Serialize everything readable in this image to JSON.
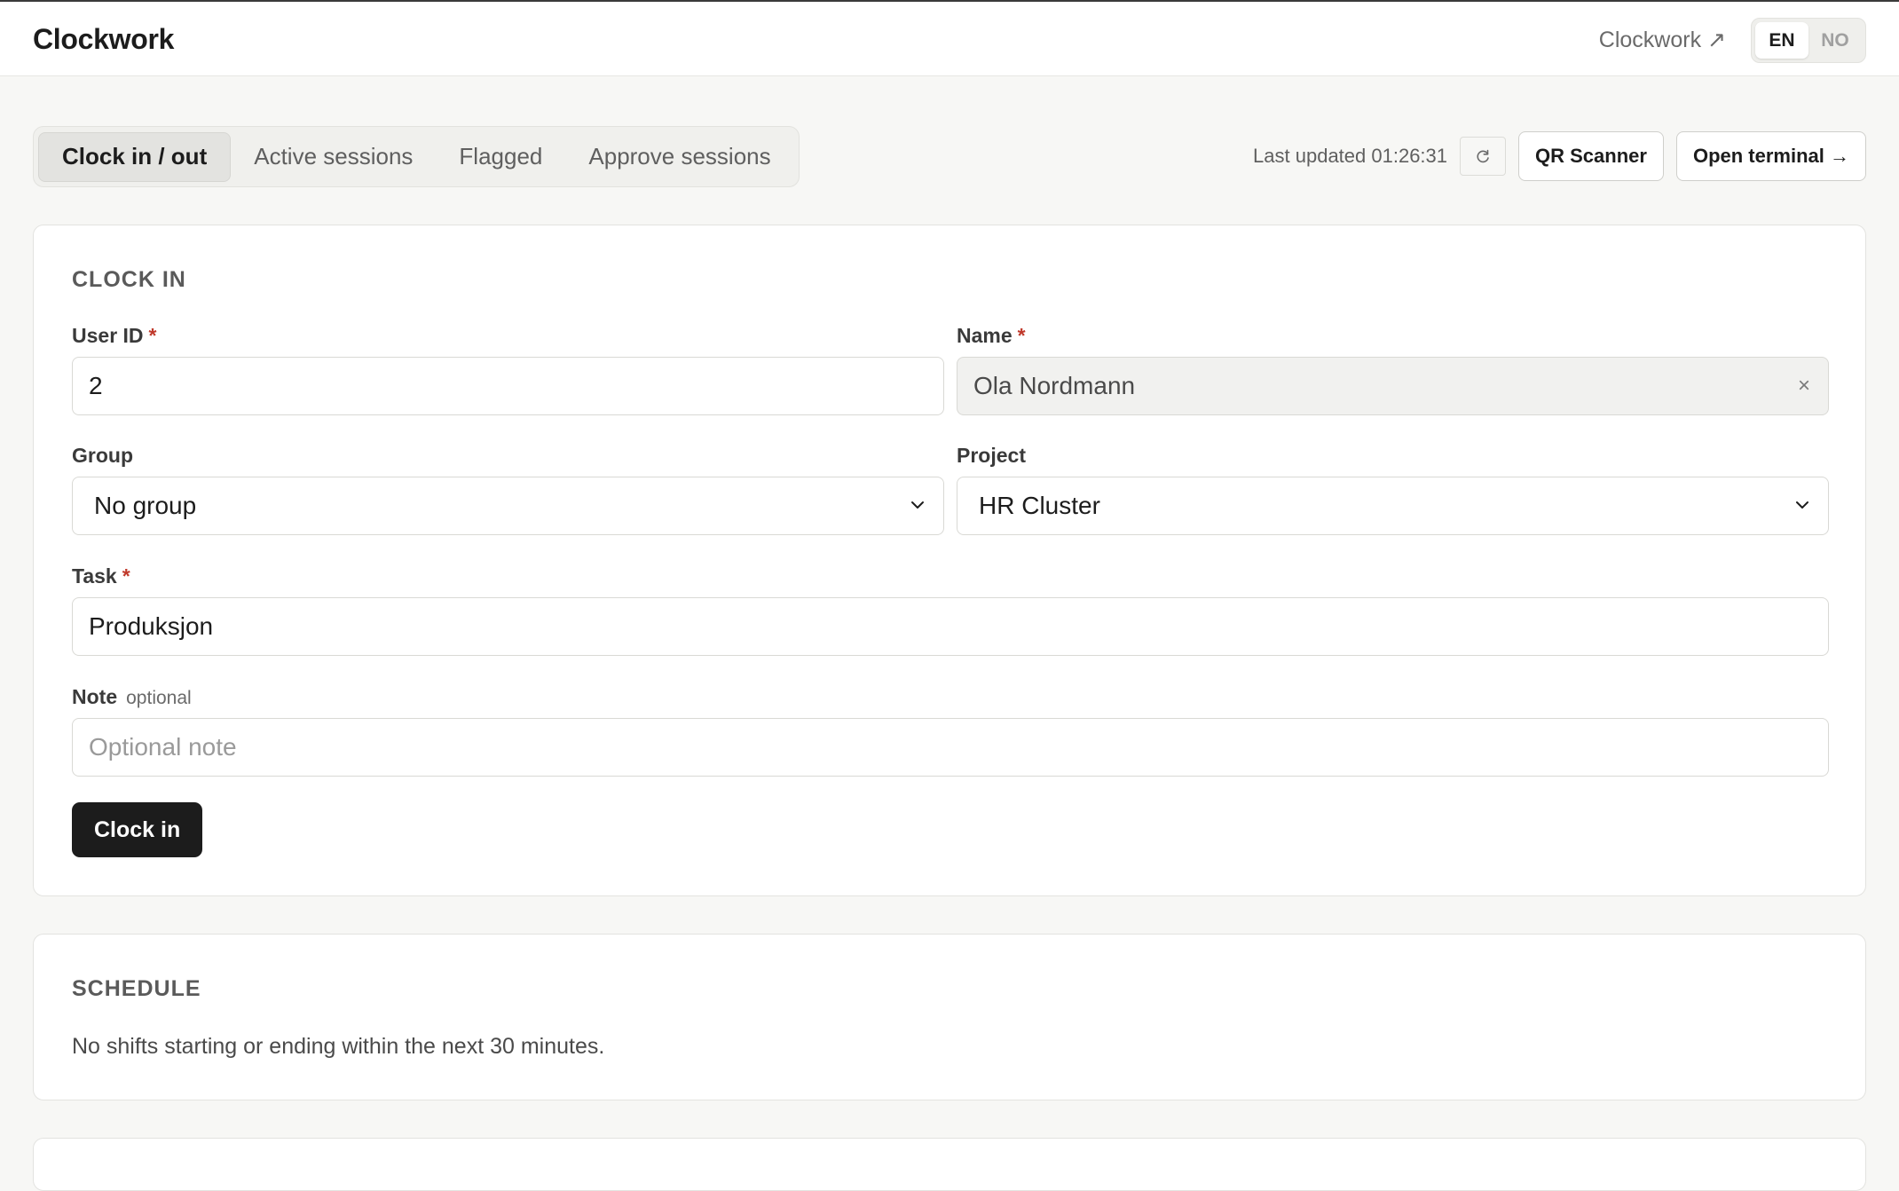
{
  "header": {
    "brand": "Clockwork",
    "external_link": "Clockwork ↗",
    "languages": [
      {
        "code": "EN",
        "active": true
      },
      {
        "code": "NO",
        "active": false
      }
    ]
  },
  "tabs": [
    {
      "label": "Clock in / out",
      "active": true
    },
    {
      "label": "Active sessions",
      "active": false
    },
    {
      "label": "Flagged",
      "active": false
    },
    {
      "label": "Approve sessions",
      "active": false
    }
  ],
  "toolbar": {
    "last_updated": "Last updated 01:26:31",
    "refresh_icon": "refresh-icon",
    "qr_button": "QR Scanner",
    "terminal_button": "Open terminal →"
  },
  "clock_in": {
    "title": "CLOCK IN",
    "user_id": {
      "label": "User ID",
      "required_mark": "*",
      "value": "2"
    },
    "name": {
      "label": "Name",
      "required_mark": "*",
      "value": "Ola Nordmann",
      "clear": "×"
    },
    "group": {
      "label": "Group",
      "selected": "No group"
    },
    "project": {
      "label": "Project",
      "selected": "HR Cluster"
    },
    "task": {
      "label": "Task",
      "required_mark": "*",
      "value": "Produksjon"
    },
    "note": {
      "label": "Note",
      "hint": "optional",
      "placeholder": "Optional note"
    },
    "submit": "Clock in"
  },
  "schedule": {
    "title": "SCHEDULE",
    "message": "No shifts starting or ending within the next 30 minutes."
  },
  "colors": {
    "page_bg": "#f7f7f5",
    "primary_button": "#1c1c1c",
    "required_mark": "#c0392b"
  }
}
